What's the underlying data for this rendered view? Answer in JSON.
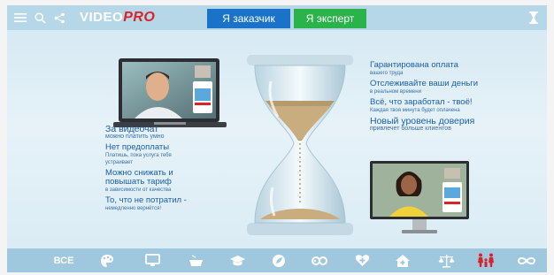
{
  "app": {
    "logo_prefix": "VIDEO",
    "logo_suffix": "PRO"
  },
  "header": {
    "customer_button": "Я заказчик",
    "expert_button": "Я эксперт"
  },
  "features_left": [
    {
      "title": "За видеочат",
      "subtitle": "можно платить умно",
      "big": true
    },
    {
      "title": "Нет предоплаты",
      "subtitle": "Платишь, пока услуга тебя устраивает"
    },
    {
      "title": "Можно снижать и повышать тариф",
      "subtitle": "в зависимости от качества"
    },
    {
      "title": "То, что не потратил -",
      "subtitle": "немедленно вернётся!"
    }
  ],
  "features_right": [
    {
      "title": "Гарантирована оплата",
      "subtitle": "вашего труда"
    },
    {
      "title": "Отслеживайте ваши деньги",
      "subtitle": "в реальном времени"
    },
    {
      "title": "Всё, что заработал - твоё!",
      "subtitle": "Каждая твоя минута будет оплачена"
    },
    {
      "title": "Новый уровень доверия",
      "subtitle": "привлечет больше клиентов",
      "big": true
    }
  ],
  "categories": {
    "all": "ВСЕ",
    "icons": [
      "palette-icon",
      "monitor-icon",
      "cooking-pot-icon",
      "graduation-cap-icon",
      "leaf-icon",
      "infinity-link-icon",
      "heart-plus-icon",
      "house-plus-icon",
      "scales-icon",
      "family-icon",
      "infinity-icon"
    ]
  },
  "colors": {
    "topbar": "#b6d7e8",
    "customer": "#1a73c9",
    "expert": "#29b34a",
    "logo_accent": "#d8232a",
    "text": "#1b5ea8",
    "active_category": "#d8232a"
  }
}
